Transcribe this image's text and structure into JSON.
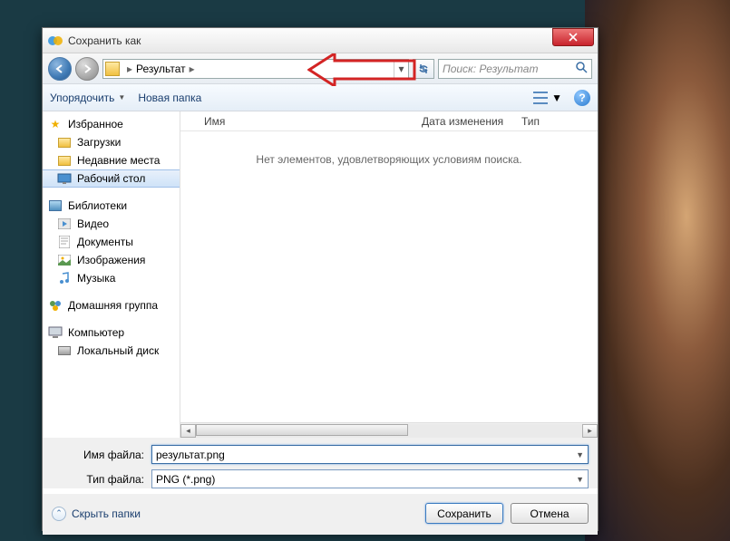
{
  "window": {
    "title": "Сохранить как"
  },
  "nav": {
    "address_folder": "Результат",
    "search_placeholder": "Поиск: Результат"
  },
  "toolbar": {
    "organize": "Упорядочить",
    "new_folder": "Новая папка"
  },
  "sidebar": {
    "favorites": {
      "header": "Избранное",
      "items": [
        "Загрузки",
        "Недавние места",
        "Рабочий стол"
      ]
    },
    "libraries": {
      "header": "Библиотеки",
      "items": [
        "Видео",
        "Документы",
        "Изображения",
        "Музыка"
      ]
    },
    "homegroup": "Домашняя группа",
    "computer": {
      "header": "Компьютер",
      "items": [
        "Локальный диск"
      ]
    }
  },
  "columns": {
    "name": "Имя",
    "date": "Дата изменения",
    "type": "Тип"
  },
  "content": {
    "empty": "Нет элементов, удовлетворяющих условиям поиска."
  },
  "form": {
    "filename_label": "Имя файла:",
    "filename_value": "результат.png",
    "filetype_label": "Тип файла:",
    "filetype_value": "PNG (*.png)"
  },
  "footer": {
    "hide_folders": "Скрыть папки",
    "save": "Сохранить",
    "cancel": "Отмена"
  }
}
